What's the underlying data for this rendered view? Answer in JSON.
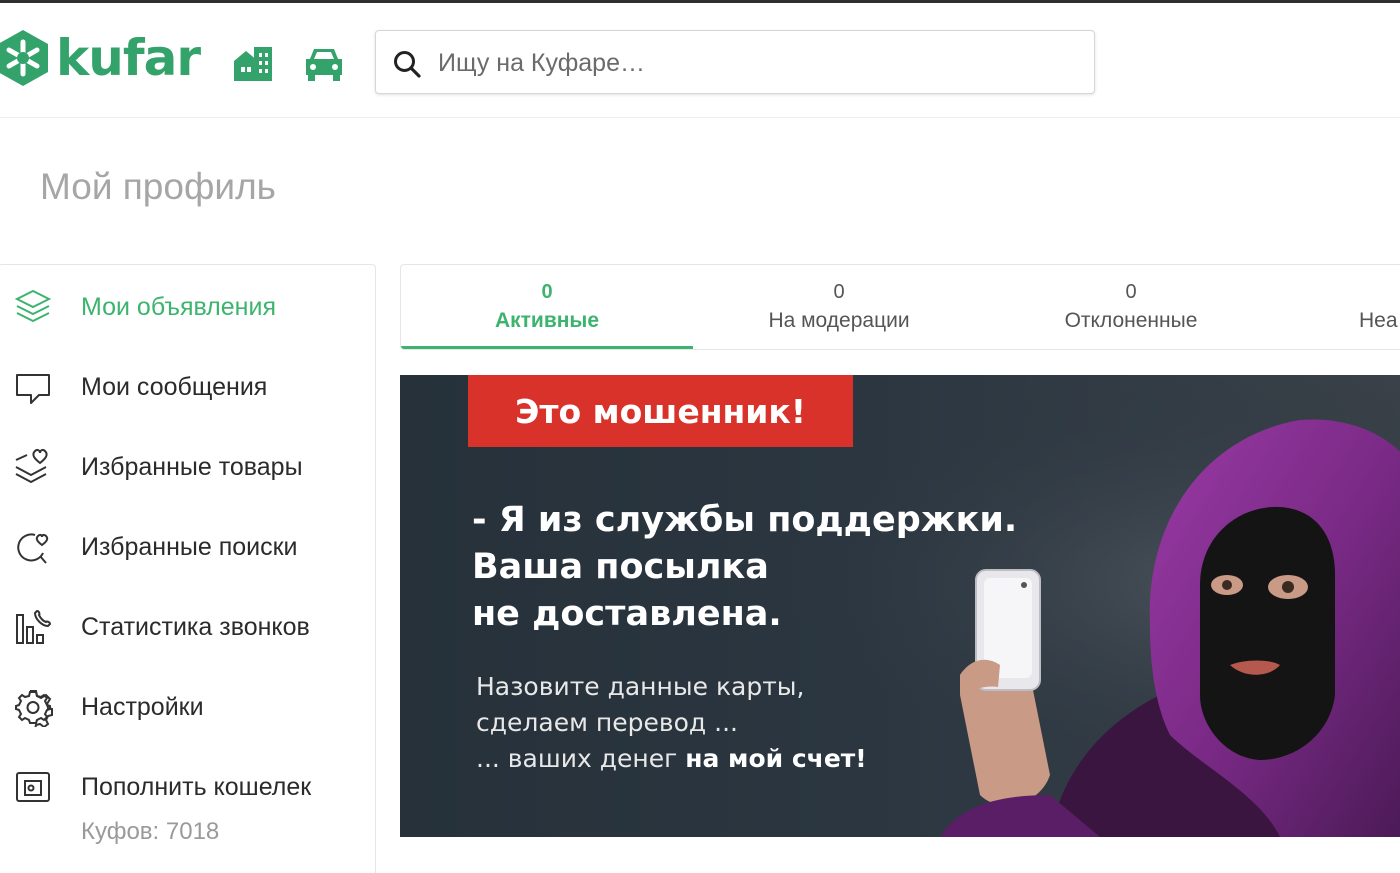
{
  "brand": {
    "name": "kufar",
    "color": "#33a36b"
  },
  "header": {
    "nav_icons": [
      "realty-icon",
      "car-icon"
    ],
    "search": {
      "placeholder": "Ищу на Куфаре…",
      "icon": "search-icon"
    }
  },
  "page": {
    "title": "Мой профиль"
  },
  "sidebar": {
    "items": [
      {
        "label": "Мои объявления",
        "icon": "layers-icon",
        "active": true
      },
      {
        "label": "Мои сообщения",
        "icon": "chat-bubble-icon",
        "active": false
      },
      {
        "label": "Избранные товары",
        "icon": "favorite-items-icon",
        "active": false
      },
      {
        "label": "Избранные поиски",
        "icon": "favorite-search-icon",
        "active": false
      },
      {
        "label": "Статистика звонков",
        "icon": "call-stats-icon",
        "active": false
      },
      {
        "label": "Настройки",
        "icon": "gear-icon",
        "active": false
      },
      {
        "label": "Пополнить кошелек",
        "icon": "wallet-icon",
        "active": false
      }
    ],
    "wallet_balance": "Куфов: 7018"
  },
  "tabs": [
    {
      "count": "0",
      "label": "Активные",
      "active": true
    },
    {
      "count": "0",
      "label": "На модерации",
      "active": false
    },
    {
      "count": "0",
      "label": "Отклоненные",
      "active": false
    },
    {
      "count": "",
      "label": "Неа",
      "active": false
    }
  ],
  "banner": {
    "warning": "Это мошенник!",
    "headline": [
      "- Я из службы поддержки.",
      "Ваша посылка",
      "не доставлена."
    ],
    "sub_lines": [
      "Назовите данные карты,",
      "сделаем перевод ..."
    ],
    "sub_last_plain": "... ваших денег ",
    "sub_last_bold": "на мой счет!",
    "accent": "#d8322a",
    "hood_color": "#7a2a86"
  },
  "colors": {
    "accent_green": "#3cb46e",
    "title_gray": "#a6a6a6"
  }
}
